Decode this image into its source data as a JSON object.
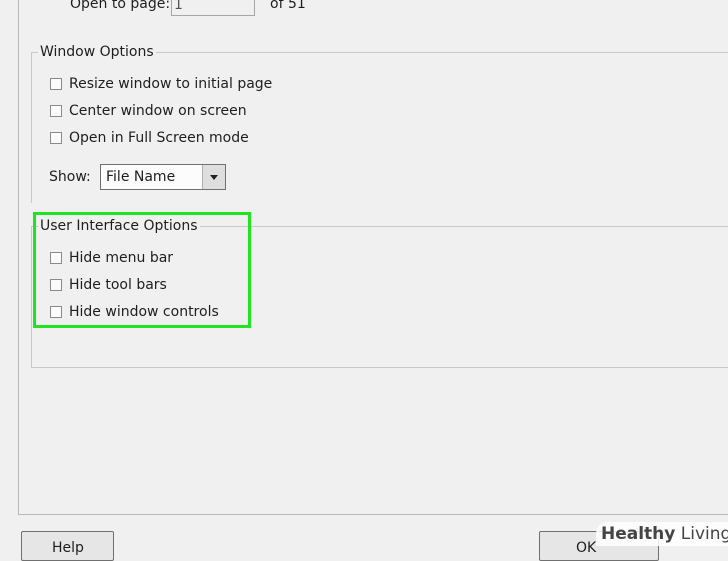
{
  "open_to_page": {
    "label": "Open to page:",
    "value": "1",
    "of_text": "of 51"
  },
  "window_options": {
    "legend": "Window Options",
    "checkboxes": [
      {
        "label": "Resize window to initial page",
        "checked": false
      },
      {
        "label": "Center window on screen",
        "checked": false
      },
      {
        "label": "Open in Full Screen mode",
        "checked": false
      }
    ],
    "show_label": "Show:",
    "show_value": "File Name"
  },
  "ui_options": {
    "legend": "User Interface Options",
    "checkboxes": [
      {
        "label": "Hide menu bar",
        "checked": false
      },
      {
        "label": "Hide tool bars",
        "checked": false
      },
      {
        "label": "Hide window controls",
        "checked": false
      }
    ]
  },
  "buttons": {
    "help": "Help",
    "ok": "OK"
  },
  "watermark": {
    "brand": "Healthy",
    "brand2": " Living"
  },
  "colors": {
    "highlight": "#22e322",
    "watermark_cross": "#2e8b57"
  }
}
